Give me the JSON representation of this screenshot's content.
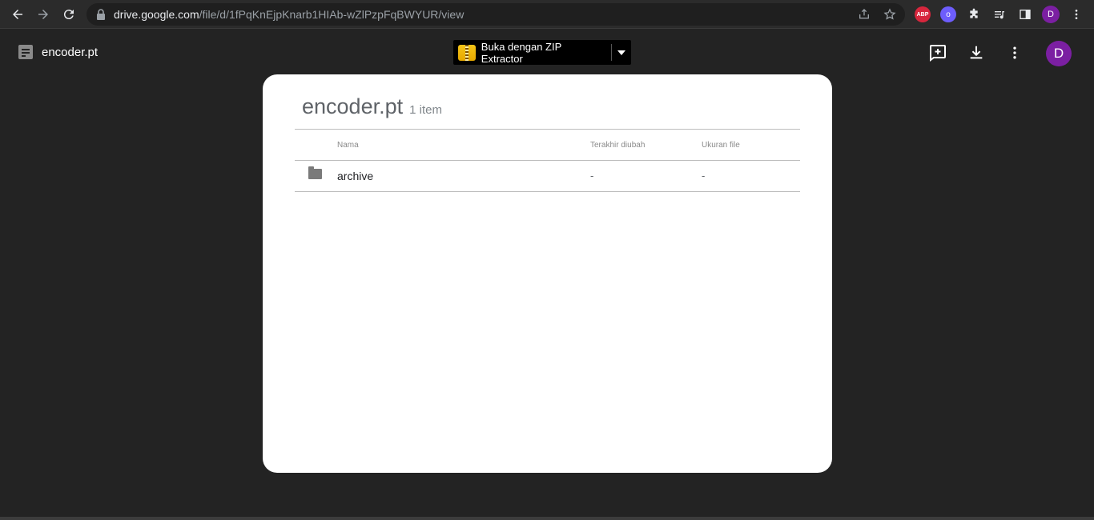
{
  "browser": {
    "url_host": "drive.google.com",
    "url_path": "/file/d/1fPqKnEjpKnarb1HIAb-wZlPzpFqBWYUR/view",
    "extensions": [
      "ABP",
      "o"
    ],
    "profile_initial": "D"
  },
  "viewer": {
    "file_name": "encoder.pt",
    "open_with_label": "Buka dengan ZIP Extractor",
    "avatar_initial": "D"
  },
  "card": {
    "title": "encoder.pt",
    "count": "1 item",
    "columns": {
      "name": "Nama",
      "modified": "Terakhir diubah",
      "size": "Ukuran file"
    },
    "rows": [
      {
        "name": "archive",
        "modified": "-",
        "size": "-"
      }
    ]
  },
  "colors": {
    "background": "#232323",
    "accent_avatar": "#7b1fa2"
  }
}
